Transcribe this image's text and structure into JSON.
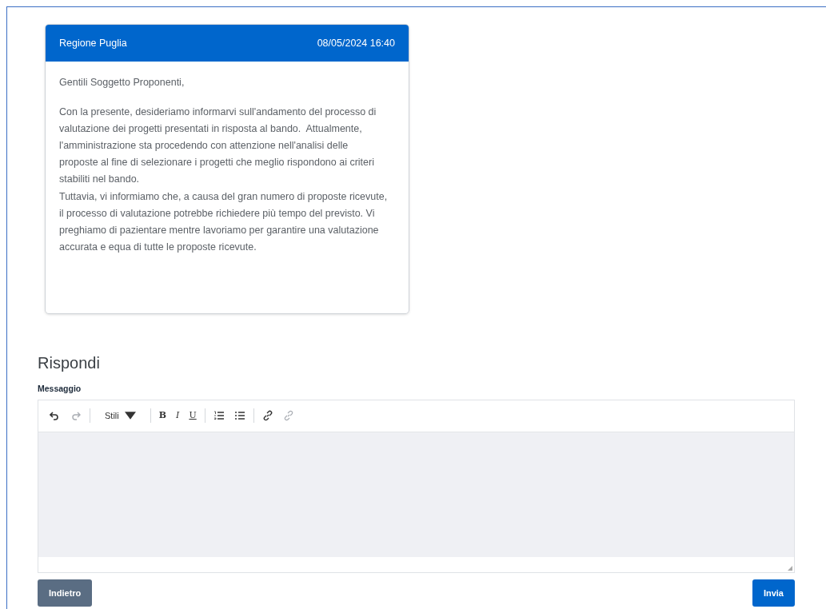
{
  "message": {
    "sender": "Regione Puglia",
    "datetime": "08/05/2024 16:40",
    "greeting": "Gentili Soggetto Proponenti,",
    "paragraphs": [
      "Con la presente, desideriamo informarvi sull'andamento del processo di valutazione dei progetti presentati in risposta al bando.  Attualmente, l'amministrazione sta procedendo con attenzione nell'analisi delle proposte al fine di selezionare i progetti che meglio rispondono ai criteri stabiliti nel bando.",
      "Tuttavia, vi informiamo che, a causa del gran numero di proposte ricevute, il processo di valutazione potrebbe richiedere più tempo del previsto. Vi preghiamo di pazientare mentre lavoriamo per garantire una valutazione accurata e equa di tutte le proposte ricevute."
    ]
  },
  "reply": {
    "title": "Rispondi",
    "label": "Messaggio",
    "toolbar": [
      {
        "kind": "undo",
        "disabled": false
      },
      {
        "kind": "redo",
        "disabled": true
      },
      {
        "kind": "separator"
      },
      {
        "kind": "styles",
        "label": "Stili",
        "disabled": false
      },
      {
        "kind": "separator"
      },
      {
        "kind": "bold",
        "label": "B",
        "disabled": false
      },
      {
        "kind": "italic",
        "label": "I",
        "disabled": false
      },
      {
        "kind": "underline",
        "label": "U",
        "disabled": false
      },
      {
        "kind": "separator"
      },
      {
        "kind": "ordered-list",
        "disabled": false
      },
      {
        "kind": "bullet-list",
        "disabled": false
      },
      {
        "kind": "separator"
      },
      {
        "kind": "link",
        "disabled": false
      },
      {
        "kind": "unlink",
        "disabled": true
      }
    ]
  },
  "buttons": {
    "back": "Indietro",
    "send": "Invia"
  }
}
